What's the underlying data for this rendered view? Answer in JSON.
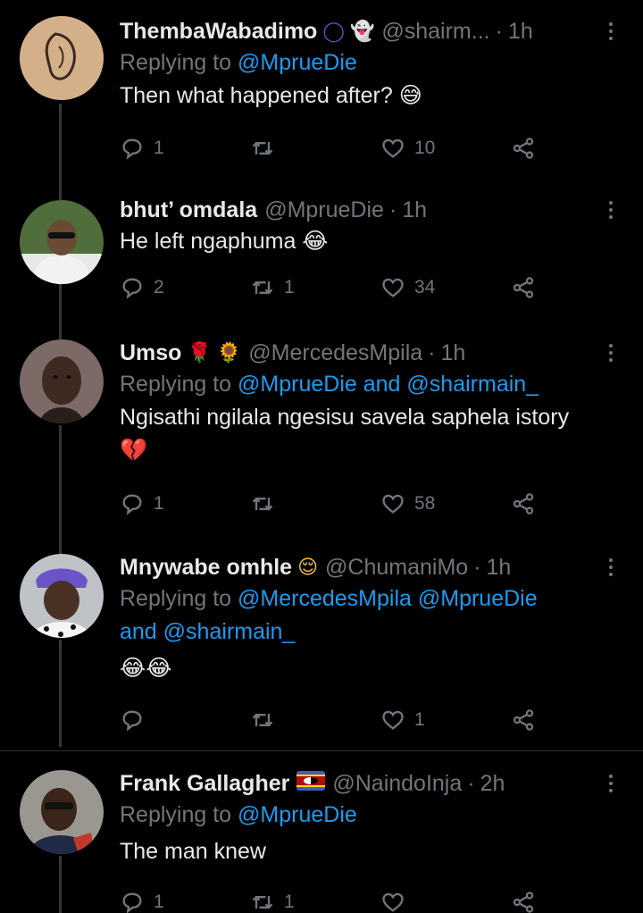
{
  "tweets": [
    {
      "name": "ThembaWabadimo",
      "badges": [
        "◯",
        "👻"
      ],
      "handle": "@shairm...",
      "time": "1h",
      "reply_prefix": "Replying to",
      "reply_links": "@MprueDie",
      "reply_links_2": "",
      "text": "Then what happened after? 😅",
      "replies": "1",
      "retweets": "",
      "likes": "10"
    },
    {
      "name": "bhut’ omdala",
      "handle": "@MprueDie",
      "time": "1h",
      "text": "He left ngaphuma 😂",
      "replies": "2",
      "retweets": "1",
      "likes": "34"
    },
    {
      "name": "Umso",
      "badges": [
        "🌹",
        "🌻"
      ],
      "handle": "@MercedesMpila",
      "time": "1h",
      "reply_prefix": "Replying to",
      "reply_links": "@MprueDie",
      "reply_and": "and",
      "reply_links_2": "@shairmain_",
      "text": "Ngisathi ngilala ngesisu savela saphela istory",
      "text_2": "💔",
      "replies": "1",
      "retweets": "",
      "likes": "58"
    },
    {
      "name": "Mnywabe omhle",
      "badges": [
        "😌"
      ],
      "handle": "@ChumaniMo",
      "time": "1h",
      "reply_prefix": "Replying to",
      "reply_links": "@MercedesMpila @MprueDie",
      "reply_and": "and",
      "reply_links_2": "@shairmain_",
      "text": "😂😂",
      "replies": "",
      "retweets": "",
      "likes": "1"
    },
    {
      "name": "Frank Gallagher",
      "badges": [
        "🇸🇿"
      ],
      "handle": "@NaindoInja",
      "time": "2h",
      "reply_prefix": "Replying to",
      "reply_links": "@MprueDie",
      "text": "The man knew",
      "replies": "1",
      "retweets": "1",
      "likes": ""
    }
  ],
  "separator": "·",
  "colors": {
    "background": "#000000",
    "text": "#e7e9ea",
    "muted": "#71767b",
    "link": "#1d9bf0",
    "divider": "#2f3336"
  },
  "icons": [
    "reply-icon",
    "retweet-icon",
    "like-icon",
    "share-icon",
    "more-icon"
  ]
}
